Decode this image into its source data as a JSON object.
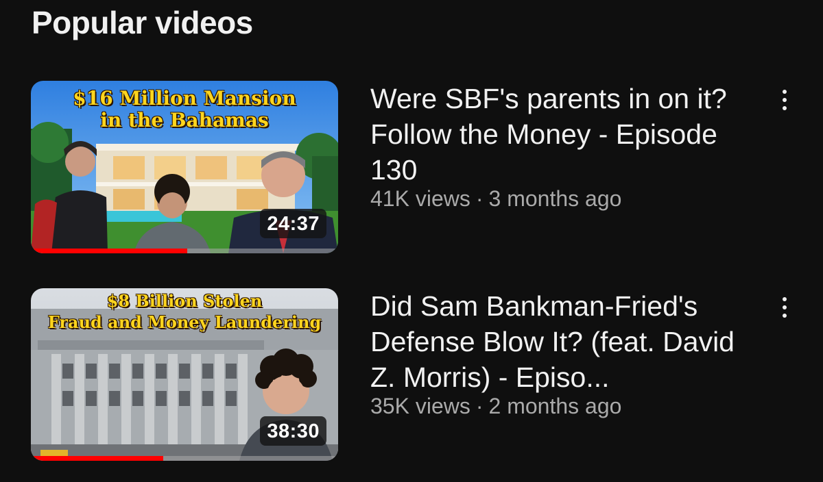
{
  "section": {
    "title": "Popular videos"
  },
  "videos": [
    {
      "title": "Were SBF's parents in on it? Follow the Money - Episode 130",
      "views": "41K views",
      "separator": "·",
      "age": "3 months ago",
      "duration": "24:37",
      "watch_progress": 0.51,
      "thumbnail_text": [
        "$16 Million Mansion",
        "in the Bahamas"
      ],
      "more_icon": "more-vert-icon"
    },
    {
      "title": "Did Sam Bankman-Fried's Defense Blow It? (feat. David Z. Morris) - Episo...",
      "views": "35K views",
      "separator": "·",
      "age": "2 months ago",
      "duration": "38:30",
      "watch_progress": 0.43,
      "thumbnail_text": [
        "$8 Billion Stolen",
        "Fraud and Money Laundering"
      ],
      "more_icon": "more-vert-icon"
    }
  ],
  "colors": {
    "background": "#0f0f0f",
    "progress": "#ff0000",
    "thumb_text": "#ffd51e",
    "secondary_text": "#aaaaaa"
  }
}
